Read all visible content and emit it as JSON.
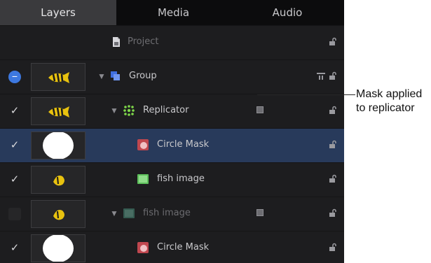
{
  "tabs": [
    {
      "label": "Layers",
      "active": true
    },
    {
      "label": "Media",
      "active": false
    },
    {
      "label": "Audio",
      "active": false
    }
  ],
  "rows": [
    {
      "label": "Project",
      "checkbox": "none",
      "thumb": "none",
      "icon": "project-icon"
    },
    {
      "label": "Group",
      "checkbox": "mixed",
      "thumb": "fish",
      "icon": "group-icon",
      "expanded": true
    },
    {
      "label": "Replicator",
      "checkbox": "checked",
      "thumb": "fish",
      "icon": "replicator-icon",
      "expanded": true,
      "has_mask": true
    },
    {
      "label": "Circle Mask",
      "checkbox": "checked",
      "thumb": "circle",
      "icon": "mask-icon",
      "selected": true
    },
    {
      "label": "fish image",
      "checkbox": "checked",
      "thumb": "fish-single",
      "icon": "image-icon"
    },
    {
      "label": "fish image",
      "checkbox": "unchecked",
      "thumb": "fish-single",
      "icon": "image-icon",
      "expanded": true,
      "has_mask": true,
      "dimmed": true
    },
    {
      "label": "Circle Mask",
      "checkbox": "checked",
      "thumb": "circle",
      "icon": "mask-icon"
    }
  ],
  "callout": {
    "line1": "Mask applied",
    "line2": "to replicator"
  },
  "colors": {
    "panel": "#1d1d1f",
    "selection": "#283a5b",
    "accent": "#3d78e0",
    "fish": "#e8c20f"
  }
}
